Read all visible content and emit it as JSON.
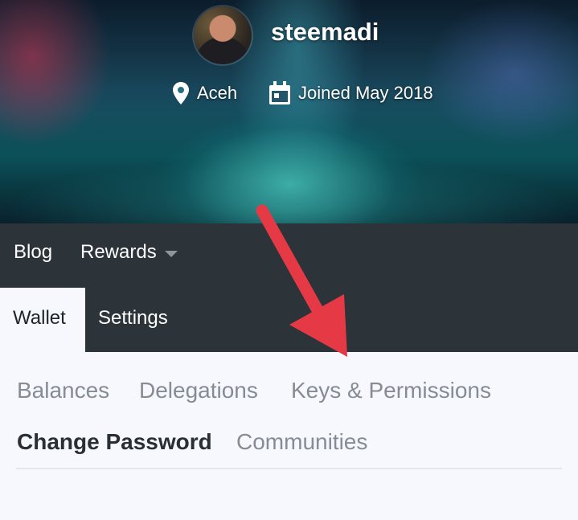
{
  "profile": {
    "username": "steemadi",
    "location": "Aceh",
    "joined": "Joined May 2018"
  },
  "icons": {
    "location": "map-pin-icon",
    "calendar": "calendar-icon",
    "caret": "caret-down-icon",
    "annotation": "red-arrow"
  },
  "nav": {
    "blog": "Blog",
    "rewards": "Rewards",
    "wallet": "Wallet",
    "settings": "Settings"
  },
  "subtabs": {
    "balances": "Balances",
    "delegations": "Delegations",
    "keys": "Keys & Permissions",
    "change_password": "Change Password",
    "communities": "Communities"
  },
  "colors": {
    "navbar": "#2c3339",
    "page_bg": "#f6f8fd",
    "arrow": "#e63946",
    "subtab_text": "#858c93",
    "active_text": "#2a2f34"
  }
}
